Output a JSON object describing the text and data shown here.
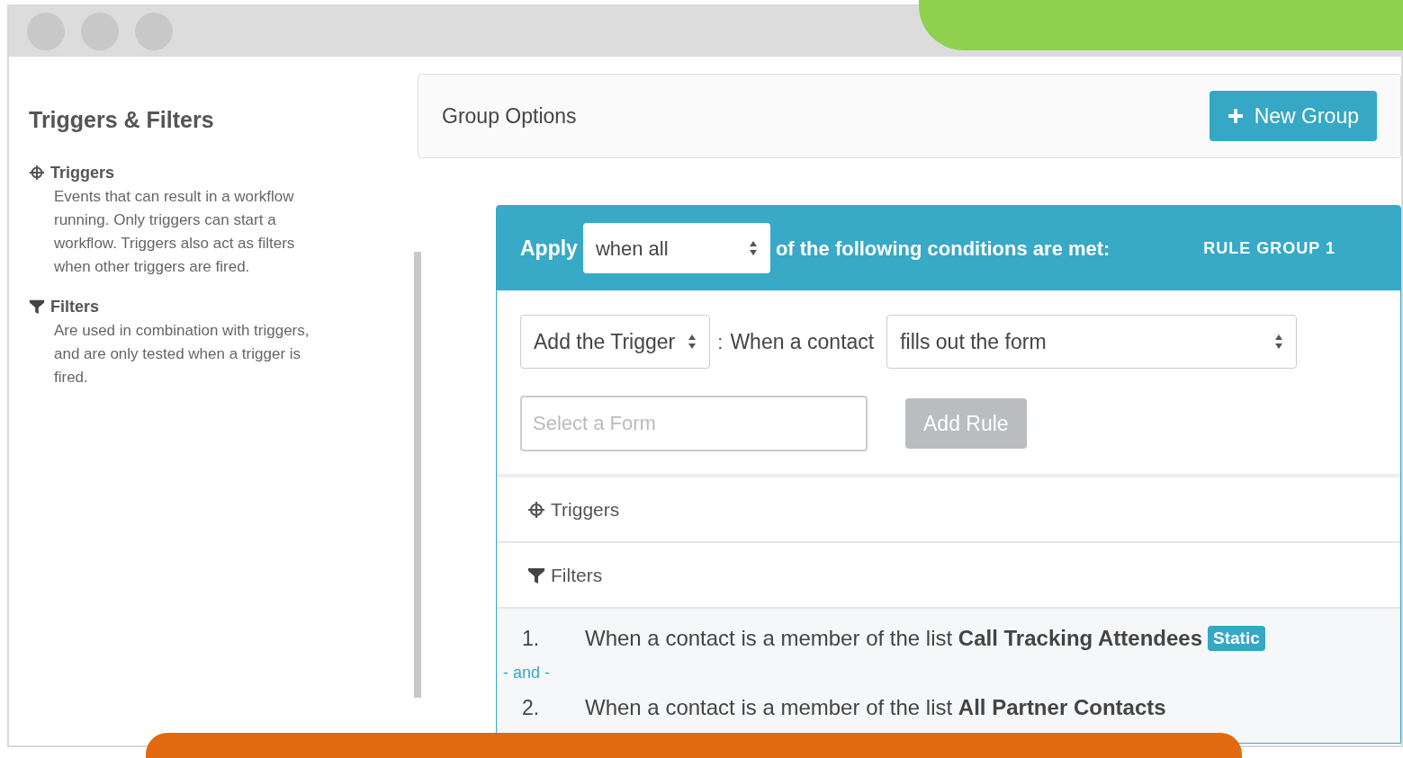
{
  "sidebar": {
    "title": "Triggers & Filters",
    "sections": [
      {
        "kind": "triggers",
        "heading": "Triggers",
        "description": "Events that can result in a workflow running. Only triggers can start a workflow. Triggers also act as filters when other triggers are fired."
      },
      {
        "kind": "filters",
        "heading": "Filters",
        "description": "Are used in combination with triggers, and are only tested when a trigger is fired."
      }
    ]
  },
  "group_options": {
    "title": "Group Options",
    "button": "New Group"
  },
  "rule_group": {
    "apply_label": "Apply",
    "match_select": "when all",
    "conditions_text": "of the following conditions are met:",
    "group_label": "RULE GROUP 1",
    "rule_type_select": "Add the Trigger",
    "separator": ":",
    "subject_label": "When a contact",
    "action_select": "fills out the form",
    "form_field": {
      "placeholder": "Select a Form"
    },
    "add_rule_button": {
      "label": "Add Rule",
      "disabled": true
    },
    "sections": [
      {
        "kind": "triggers",
        "label": "Triggers"
      },
      {
        "kind": "filters",
        "label": "Filters"
      }
    ],
    "filters": [
      {
        "number": "1.",
        "text": "When a contact is a member of the list **Call Tracking Attendees**",
        "badge": "Static"
      },
      {
        "joiner": "- and -",
        "number": "2.",
        "text": "When a contact is a member of the list **All Partner Contacts**"
      }
    ]
  }
}
